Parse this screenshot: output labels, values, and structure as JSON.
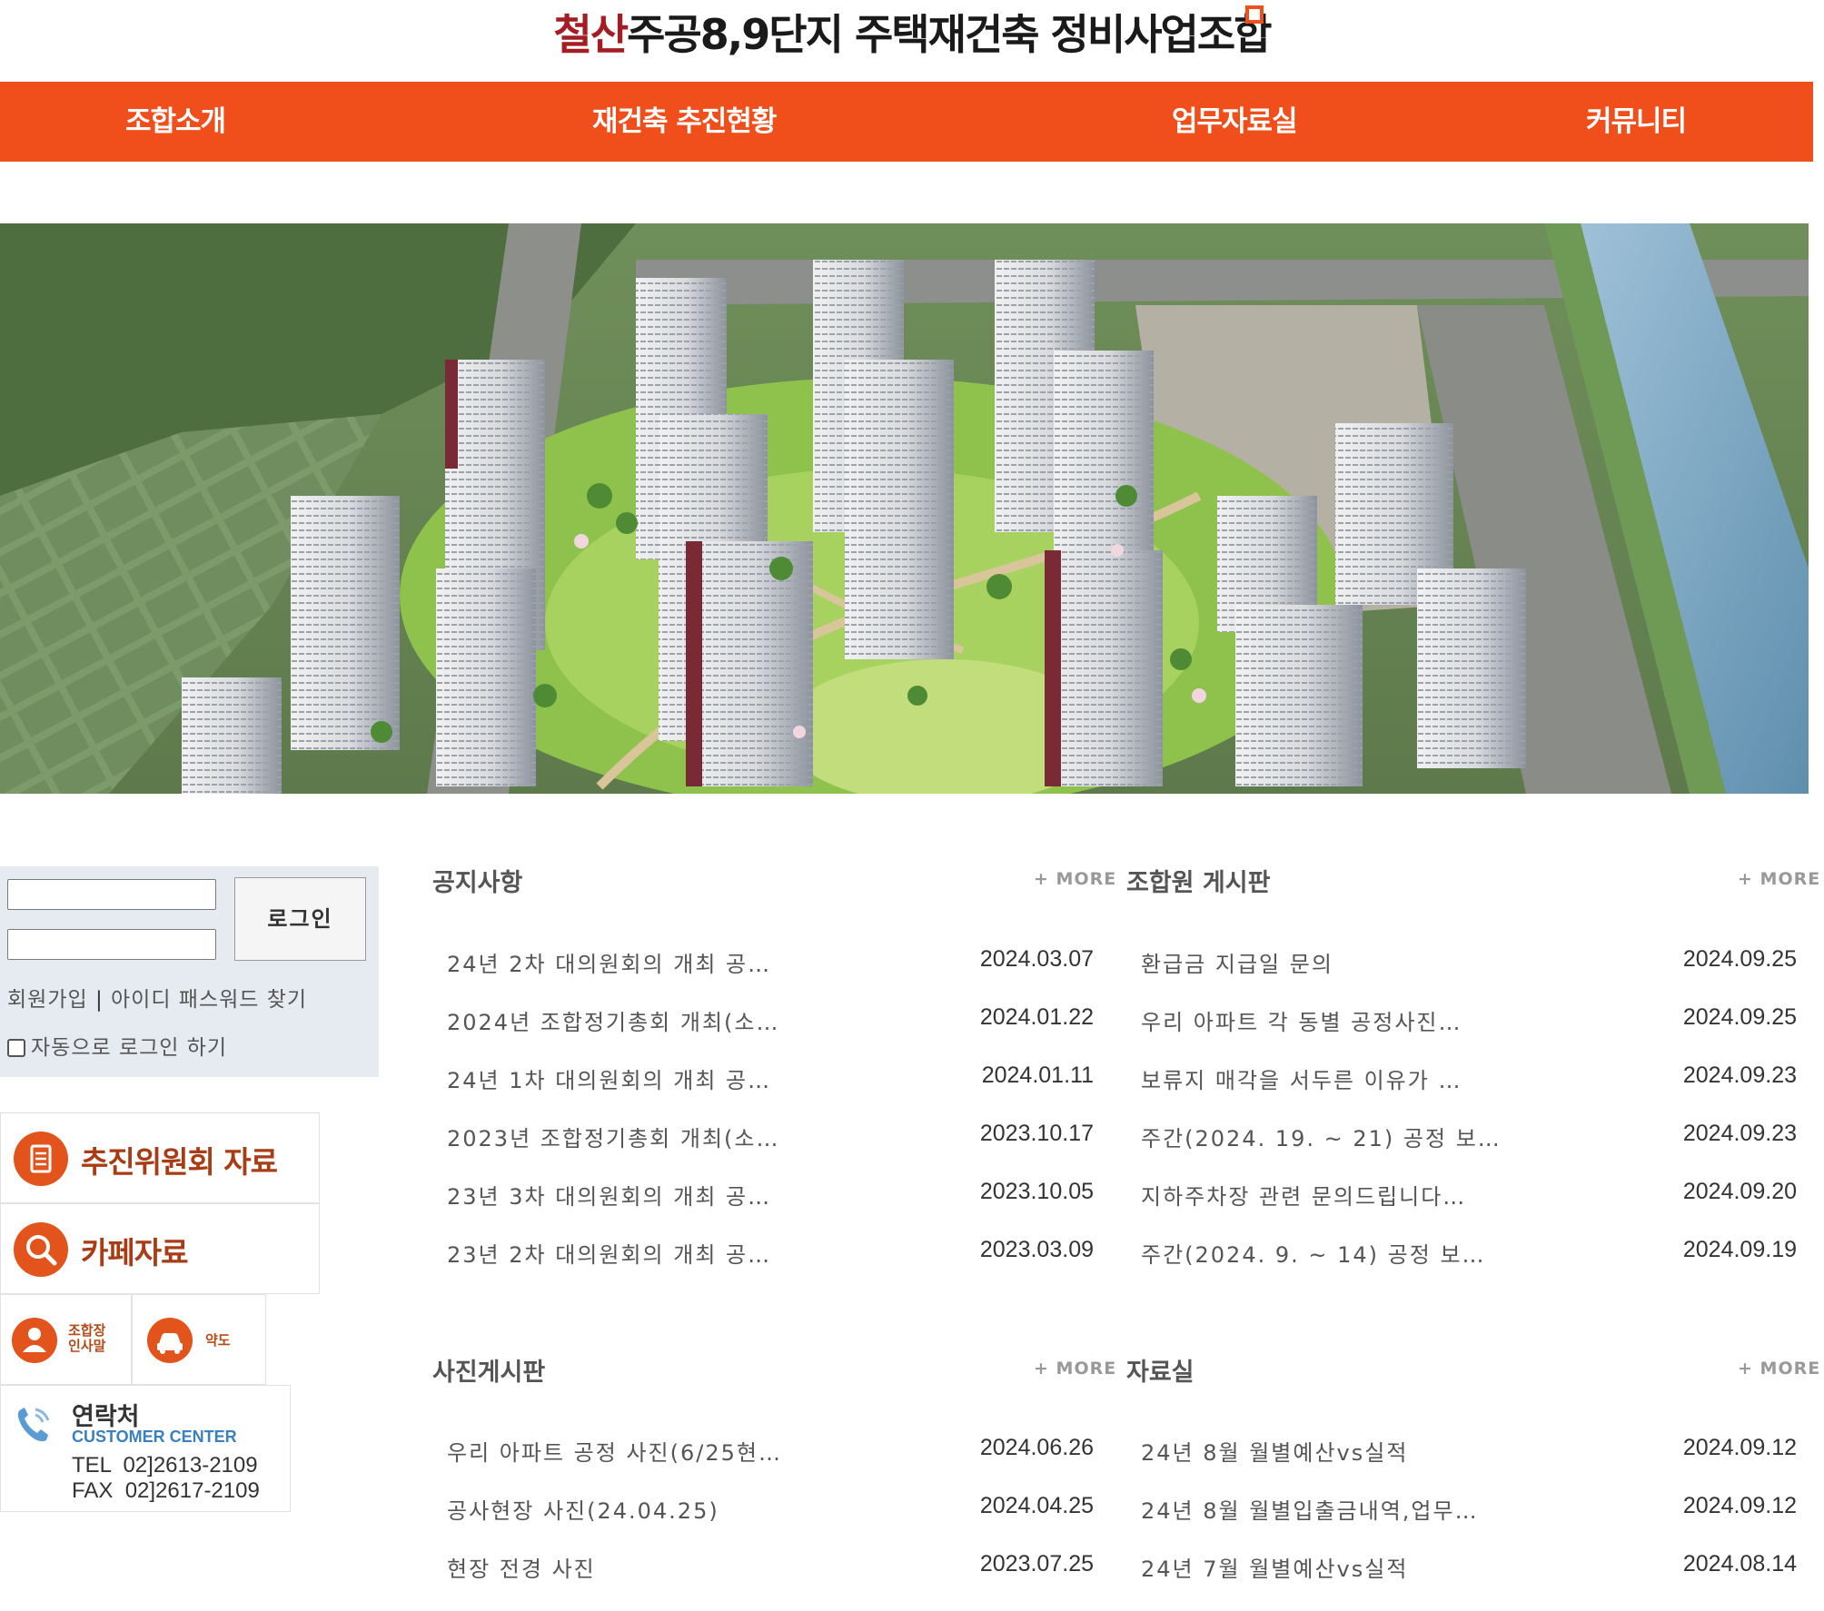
{
  "header": {
    "title_accent": "철산",
    "title_rest": "주공8,9단지 주택재건축 정비사업조합"
  },
  "nav": [
    "조합소개",
    "재건축 추진현황",
    "업무자료실",
    "커뮤니티"
  ],
  "login": {
    "button_label": "로그인",
    "signup_link": "회원가입",
    "separator": " | ",
    "find_link": "아이디 패스워드 찾기",
    "auto_login_label": "자동으로 로그인 하기"
  },
  "sidebar": {
    "committee_link": "추진위원회 자료",
    "cafe_link": "카페자료",
    "greeting_link": "조합장\n인사말",
    "map_link": "약도",
    "contact_title": "연락처",
    "contact_subtitle": "CUSTOMER CENTER",
    "tel": "TEL  02]2613-2109",
    "fax": "FAX  02]2617-2109"
  },
  "boards": {
    "more_label": "+ MORE",
    "notice": {
      "title": "공지사항",
      "rows": [
        {
          "title": "24년 2차 대의원회의 개최 공…",
          "date": "2024.03.07"
        },
        {
          "title": "2024년 조합정기총회 개최(소…",
          "date": "2024.01.22"
        },
        {
          "title": "24년 1차 대의원회의 개최 공…",
          "date": "2024.01.11"
        },
        {
          "title": "2023년 조합정기총회 개최(소…",
          "date": "2023.10.17"
        },
        {
          "title": "23년 3차 대의원회의 개최 공…",
          "date": "2023.10.05"
        },
        {
          "title": "23년 2차 대의원회의 개최 공…",
          "date": "2023.03.09"
        }
      ]
    },
    "member": {
      "title": "조합원 게시판",
      "rows": [
        {
          "title": "환급금 지급일 문의",
          "date": "2024.09.25"
        },
        {
          "title": "우리 아파트 각 동별 공정사진…",
          "date": "2024.09.25"
        },
        {
          "title": "보류지 매각을 서두른 이유가 …",
          "date": "2024.09.23"
        },
        {
          "title": "주간(2024. 19. ~ 21) 공정 보…",
          "date": "2024.09.23"
        },
        {
          "title": "지하주차장 관련 문의드립니다…",
          "date": "2024.09.20"
        },
        {
          "title": "주간(2024. 9. ~ 14) 공정 보…",
          "date": "2024.09.19"
        }
      ]
    },
    "photo": {
      "title": "사진게시판",
      "rows": [
        {
          "title": "우리 아파트 공정 사진(6/25현…",
          "date": "2024.06.26"
        },
        {
          "title": "공사현장 사진(24.04.25)",
          "date": "2024.04.25"
        },
        {
          "title": "현장 전경 사진",
          "date": "2023.07.25"
        }
      ]
    },
    "archive": {
      "title": "자료실",
      "rows": [
        {
          "title": "24년 8월 월별예산vs실적",
          "date": "2024.09.12"
        },
        {
          "title": "24년 8월 월별입출금내역,업무…",
          "date": "2024.09.12"
        },
        {
          "title": "24년 7월 월별예산vs실적",
          "date": "2024.08.14"
        }
      ]
    }
  },
  "colors": {
    "brand_orange": "#f04e1a",
    "title_accent": "#a31d23",
    "sidebar_text": "#a83c14",
    "login_bg": "#e6ebf2"
  }
}
